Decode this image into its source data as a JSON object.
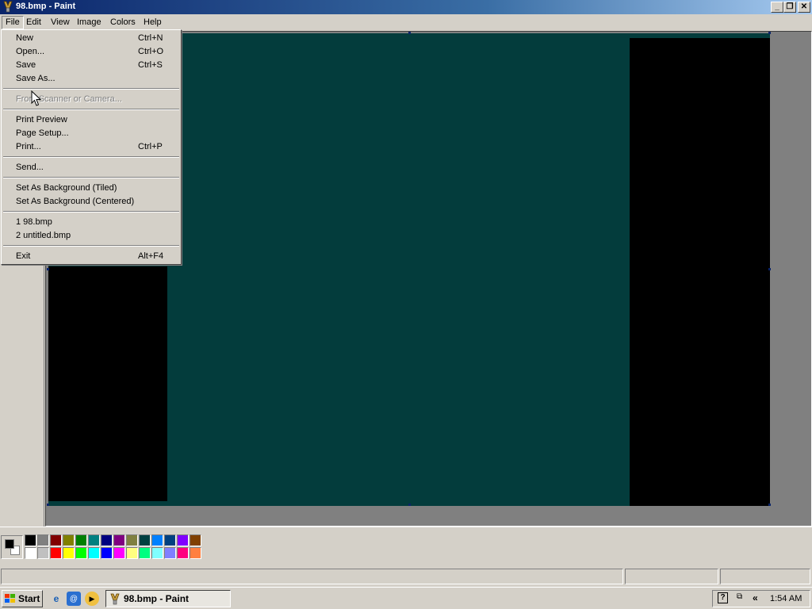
{
  "window": {
    "title": "98.bmp - Paint",
    "controls": {
      "minimize": "_",
      "maximize": "❐",
      "close": "✕"
    }
  },
  "menubar": {
    "items": [
      "File",
      "Edit",
      "View",
      "Image",
      "Colors",
      "Help"
    ],
    "active": "File"
  },
  "file_menu": {
    "items": [
      {
        "label": "New",
        "shortcut": "Ctrl+N"
      },
      {
        "label": "Open...",
        "shortcut": "Ctrl+O"
      },
      {
        "label": "Save",
        "shortcut": "Ctrl+S"
      },
      {
        "label": "Save As...",
        "shortcut": ""
      },
      {
        "label": "From Scanner or Camera...",
        "shortcut": "",
        "disabled": true
      },
      {
        "label": "Print Preview",
        "shortcut": ""
      },
      {
        "label": "Page Setup...",
        "shortcut": ""
      },
      {
        "label": "Print...",
        "shortcut": "Ctrl+P"
      },
      {
        "label": "Send...",
        "shortcut": ""
      },
      {
        "label": "Set As Background (Tiled)",
        "shortcut": ""
      },
      {
        "label": "Set As Background (Centered)",
        "shortcut": ""
      },
      {
        "label": "1 98.bmp",
        "shortcut": ""
      },
      {
        "label": "2 untitled.bmp",
        "shortcut": ""
      },
      {
        "label": "Exit",
        "shortcut": "Alt+F4"
      }
    ]
  },
  "canvas": {
    "background_color": "#033c3c",
    "shape_color": "#000000"
  },
  "palette": {
    "foreground": "#000000",
    "background": "#ffffff",
    "top_row": [
      "#000000",
      "#808080",
      "#800000",
      "#808000",
      "#008000",
      "#008080",
      "#000080",
      "#800080",
      "#808040",
      "#004040",
      "#0080ff",
      "#004080",
      "#8000ff",
      "#804000"
    ],
    "bottom_row": [
      "#ffffff",
      "#c0c0c0",
      "#ff0000",
      "#ffff00",
      "#00ff00",
      "#00ffff",
      "#0000ff",
      "#ff00ff",
      "#ffff80",
      "#00ff80",
      "#80ffff",
      "#8080ff",
      "#ff0080",
      "#ff8040"
    ]
  },
  "taskbar": {
    "start_label": "Start",
    "task_label": "98.bmp - Paint",
    "clock": "1:54 AM",
    "tray_icons": [
      "help-icon",
      "network-icon",
      "chevron-left-icon"
    ]
  }
}
